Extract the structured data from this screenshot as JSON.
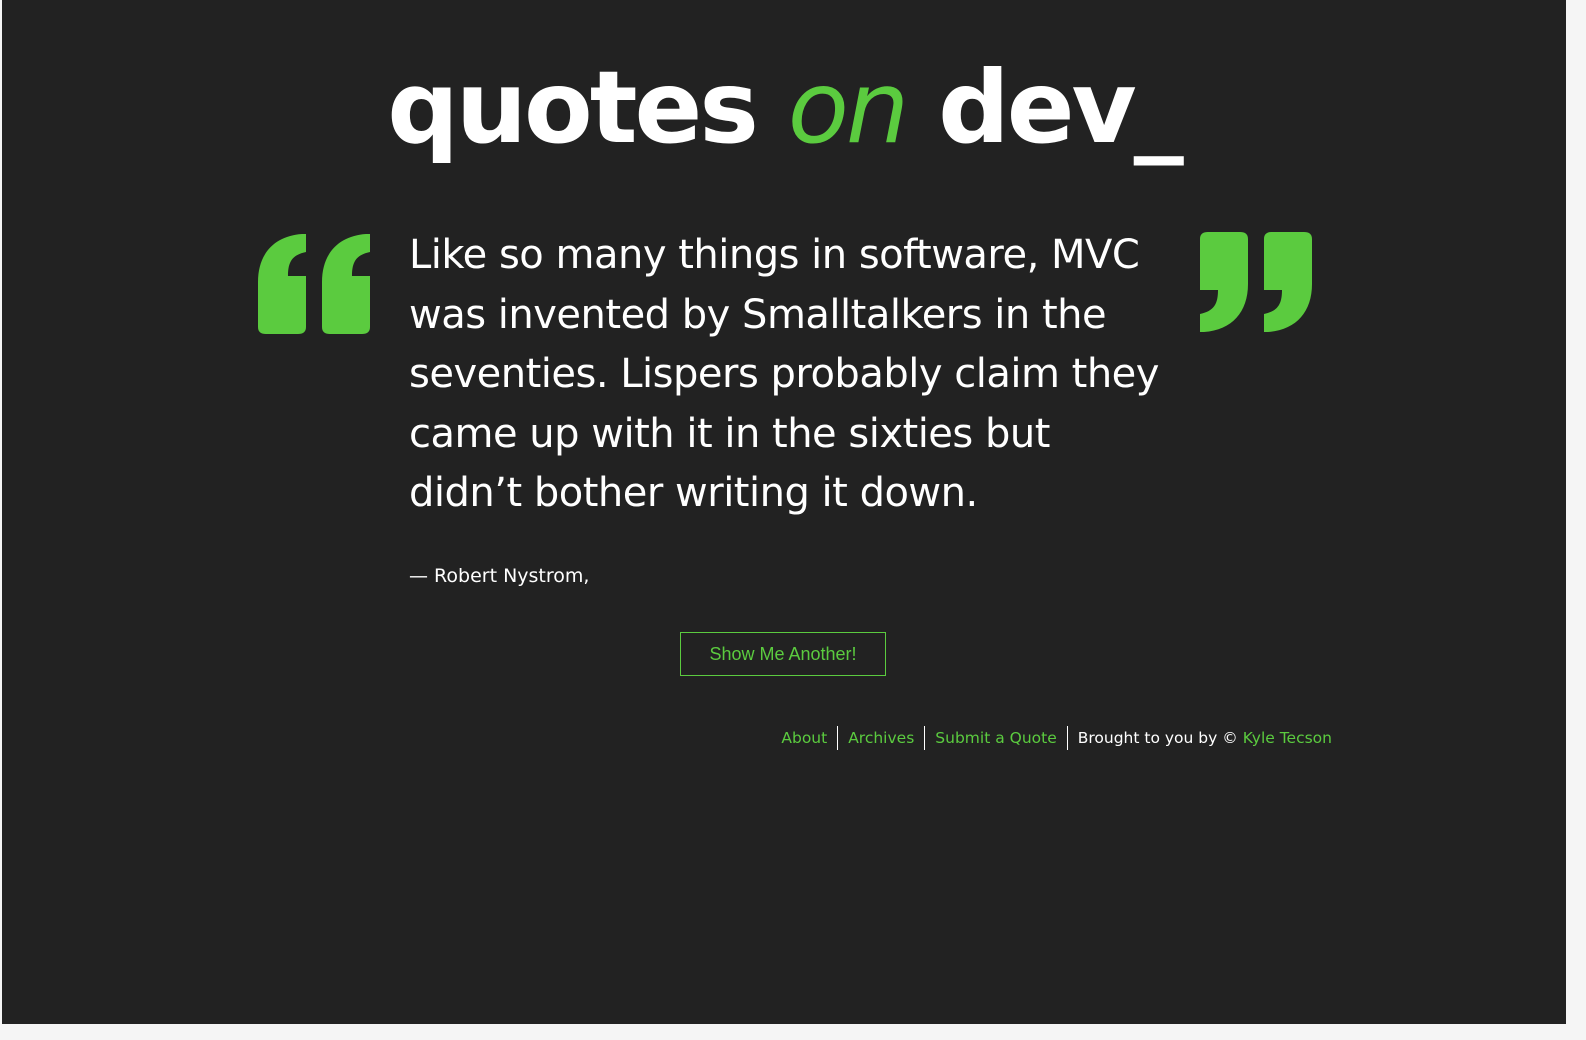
{
  "site": {
    "title_part1": "quotes",
    "title_part2": "on",
    "title_part3": "dev_"
  },
  "quote": {
    "text": "Like so many things in software, MVC was invented by Smalltalkers in the seventies. Lispers probably claim they came up with it in the sixties but didn’t bother writing it down.",
    "author": "— Robert Nystrom,"
  },
  "actions": {
    "show_another_label": "Show Me Another!"
  },
  "footer": {
    "links": [
      {
        "label": "About"
      },
      {
        "label": "Archives"
      },
      {
        "label": "Submit a Quote"
      }
    ],
    "credit_text": "Brought to you by ©",
    "credit_author": "Kyle Tecson"
  },
  "icons": {
    "open_quote": "open-quote-icon",
    "close_quote": "close-quote-icon"
  },
  "colors": {
    "background": "#222222",
    "accent": "#5bcb3f",
    "text": "#ffffff"
  }
}
